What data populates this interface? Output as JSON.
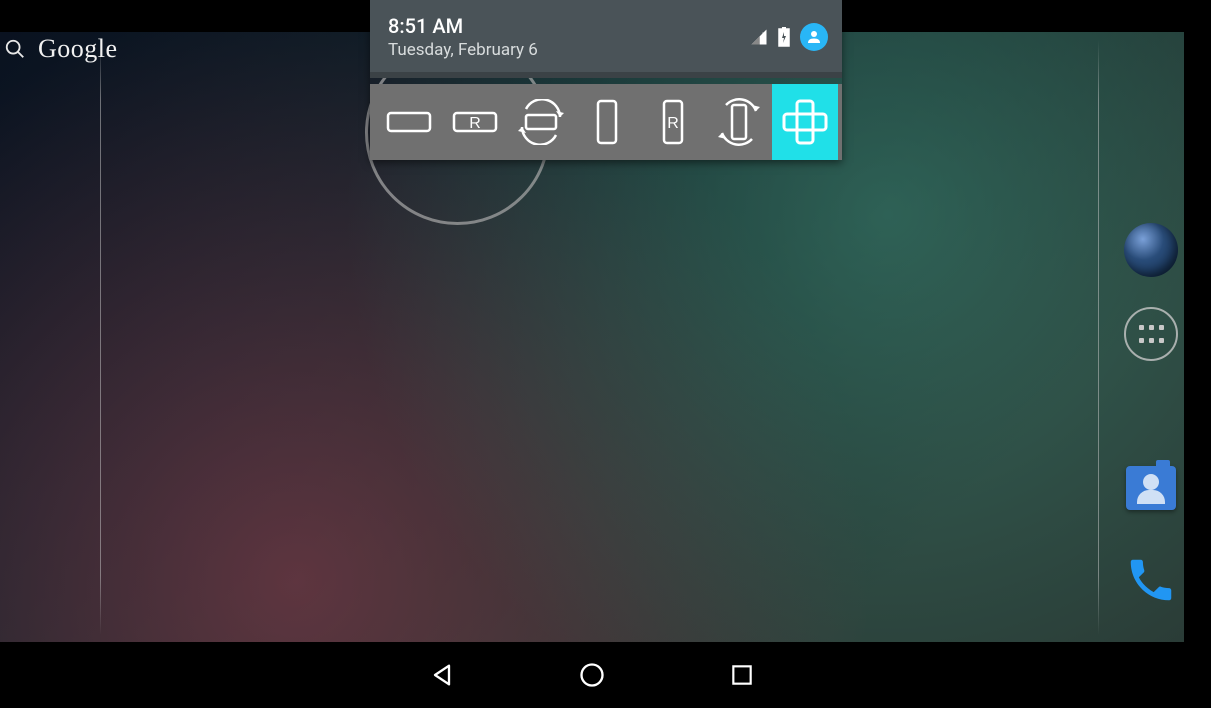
{
  "shade": {
    "time": "8:51 AM",
    "date": "Tuesday, February 6",
    "icons": {
      "signal": "cellular-signal-icon",
      "battery": "battery-charging-icon",
      "profile": "user-avatar-icon"
    }
  },
  "search": {
    "label": "Google"
  },
  "rotation_toolbar": {
    "options": [
      {
        "id": "landscape",
        "label": "",
        "active": false
      },
      {
        "id": "landscape-reverse",
        "label": "R",
        "active": false
      },
      {
        "id": "landscape-auto",
        "label": "",
        "active": false
      },
      {
        "id": "portrait",
        "label": "",
        "active": false
      },
      {
        "id": "portrait-reverse",
        "label": "R",
        "active": false
      },
      {
        "id": "portrait-auto",
        "label": "",
        "active": false
      },
      {
        "id": "full-sensor",
        "label": "",
        "active": true
      }
    ]
  },
  "side": {
    "browser": "browser-app",
    "apps": "all-apps",
    "contacts": "contacts-app",
    "phone": "phone-app"
  },
  "nav": {
    "back": "back",
    "home": "home",
    "recent": "recent-apps"
  }
}
